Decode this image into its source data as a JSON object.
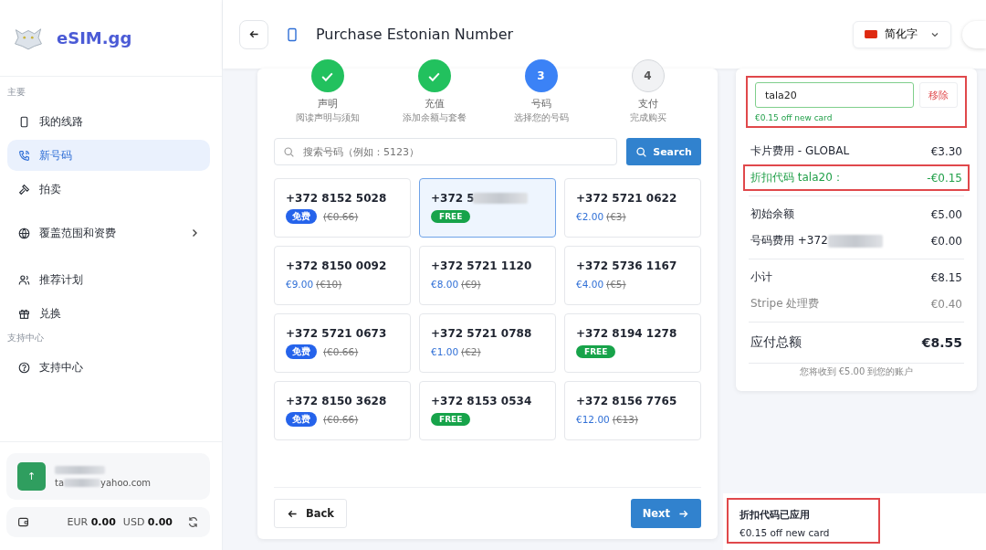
{
  "brand": {
    "name": "eSIM.gg"
  },
  "sidebar": {
    "sections": [
      {
        "heading": "主要",
        "items": [
          {
            "label": "我的线路",
            "selected": false,
            "chevron": false
          },
          {
            "label": "新号码",
            "selected": true,
            "chevron": false
          },
          {
            "label": "拍卖",
            "selected": false,
            "chevron": false
          },
          {
            "label": "覆盖范围和资费",
            "selected": false,
            "chevron": true
          },
          {
            "label": "推荐计划",
            "selected": false,
            "chevron": false
          },
          {
            "label": "兑换",
            "selected": false,
            "chevron": false
          }
        ]
      },
      {
        "heading": "支持中心",
        "items": [
          {
            "label": "支持中心",
            "selected": false,
            "chevron": false
          }
        ]
      }
    ],
    "user": {
      "avatar": "↑",
      "email_start": "ta",
      "email_end": "yahoo.com"
    },
    "balance": [
      {
        "currency": "EUR",
        "amount": "0.00"
      },
      {
        "currency": "USD",
        "amount": "0.00"
      }
    ]
  },
  "header": {
    "title": "Purchase Estonian Number",
    "language": "简化字"
  },
  "steps": [
    {
      "label": "声明",
      "sub": "阅读声明与须知",
      "completed": true,
      "selected": false
    },
    {
      "label": "充值",
      "sub": "添加余额与套餐",
      "completed": true,
      "selected": false
    },
    {
      "number": "3",
      "label": "号码",
      "sub": "选择您的号码",
      "completed": false,
      "selected": true
    },
    {
      "number": "4",
      "label": "支付",
      "sub": "完成购买",
      "completed": false,
      "selected": false
    }
  ],
  "search": {
    "placeholder": "搜索号码（例如：5123）",
    "button": "Search"
  },
  "numbers": [
    {
      "number": "+372 8152 5028",
      "kind": "promo",
      "badge": "免费",
      "original": "(€0.66)",
      "selected": false
    },
    {
      "number": "+372 5",
      "kind": "free",
      "badge": "FREE",
      "selected": true,
      "blurred": true
    },
    {
      "number": "+372 5721 0622",
      "kind": "price",
      "price": "€2.00",
      "original": "(€3)",
      "selected": false
    },
    {
      "number": "+372 8150 0092",
      "kind": "price",
      "price": "€9.00",
      "original": "(€10)",
      "selected": false
    },
    {
      "number": "+372 5721 1120",
      "kind": "price",
      "price": "€8.00",
      "original": "(€9)",
      "selected": false
    },
    {
      "number": "+372 5736 1167",
      "kind": "price",
      "price": "€4.00",
      "original": "(€5)",
      "selected": false
    },
    {
      "number": "+372 5721 0673",
      "kind": "promo",
      "badge": "免费",
      "original": "(€0.66)",
      "selected": false
    },
    {
      "number": "+372 5721 0788",
      "kind": "price",
      "price": "€1.00",
      "original": "(€2)",
      "selected": false
    },
    {
      "number": "+372 8194 1278",
      "kind": "free",
      "badge": "FREE",
      "selected": false
    },
    {
      "number": "+372 8150 3628",
      "kind": "promo",
      "badge": "免费",
      "original": "(€0.66)",
      "selected": false
    },
    {
      "number": "+372 8153 0534",
      "kind": "free",
      "badge": "FREE",
      "selected": false
    },
    {
      "number": "+372 8156 7765",
      "kind": "price",
      "price": "€12.00",
      "original": "(€13)",
      "selected": false
    }
  ],
  "nav": {
    "back": "Back",
    "next": "Next"
  },
  "summary": {
    "coupon": {
      "value": "tala20",
      "remove": "移除",
      "message": "€0.15 off new card",
      "highlighted": true
    },
    "groups": [
      [
        {
          "label": "卡片费用 - GLOBAL",
          "amount": "€3.30",
          "kind": "normal"
        },
        {
          "label": "折扣代码 tala20：",
          "amount": "-€0.15",
          "kind": "discount",
          "highlighted": true
        }
      ],
      [
        {
          "label": "初始余额",
          "amount": "€5.00",
          "kind": "normal"
        },
        {
          "label": "号码费用 +372",
          "amount": "€0.00",
          "kind": "normal",
          "blurred": true
        }
      ],
      [
        {
          "label": "小计",
          "amount": "€8.15",
          "kind": "normal"
        },
        {
          "label": "Stripe 处理费",
          "amount": "€0.40",
          "kind": "muted"
        }
      ],
      [
        {
          "label": "应付总额",
          "amount": "€8.55",
          "kind": "total"
        }
      ]
    ],
    "note": "您将收到 €5.00 到您的账户"
  },
  "toast": {
    "title": "折扣代码已应用",
    "text": "€0.15 off new card",
    "highlighted": true
  }
}
